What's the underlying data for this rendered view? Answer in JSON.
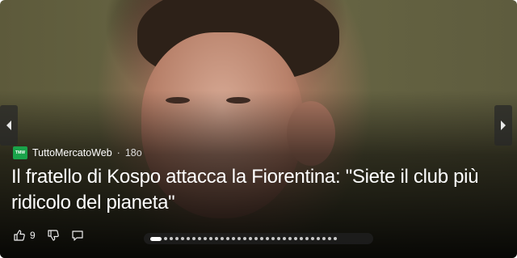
{
  "card": {
    "source_name": "TuttoMercatoWeb",
    "source_logo_text": "TMW",
    "separator": "·",
    "time": "18o",
    "headline": "Il fratello di Kospo attacca la Fiorentina: \"Siete il club più ridicolo del pianeta\"",
    "likes_count": "9"
  },
  "icons": {
    "prev": "chevron-left-icon",
    "next": "chevron-right-icon",
    "like": "thumbs-up-icon",
    "dislike": "thumbs-down-icon",
    "comment": "comment-icon"
  },
  "pager": {
    "total": 32,
    "active_index": 0
  },
  "colors": {
    "source_logo": "#1aa34a",
    "overlay": "#000000",
    "text": "#ffffff"
  }
}
